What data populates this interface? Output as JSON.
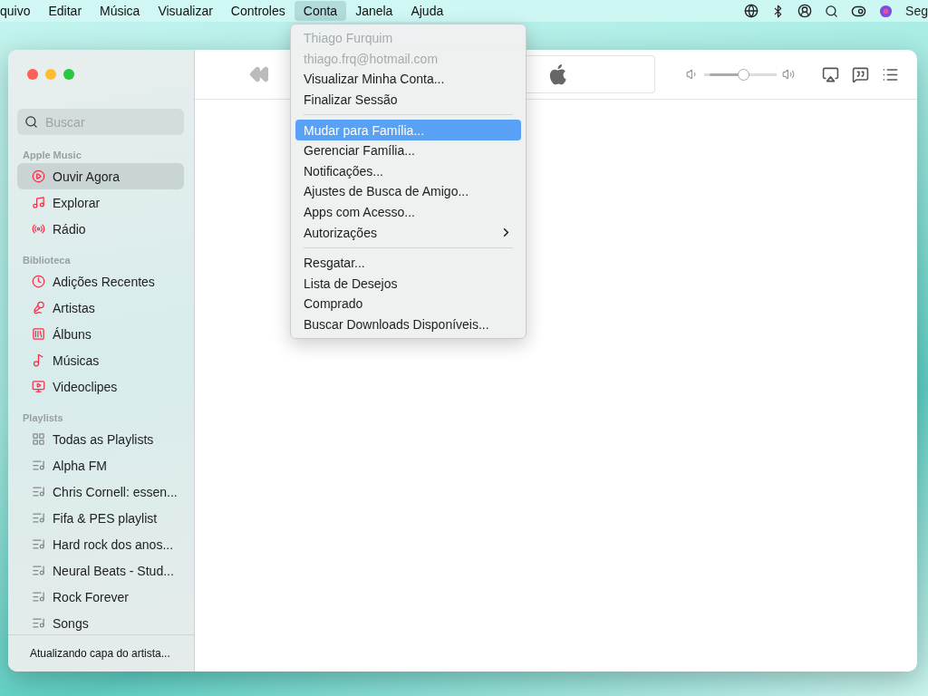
{
  "menu_bar": {
    "items": [
      {
        "label": "quivo",
        "selected": false
      },
      {
        "label": "Editar",
        "selected": false
      },
      {
        "label": "Música",
        "selected": false
      },
      {
        "label": "Visualizar",
        "selected": false
      },
      {
        "label": "Controles",
        "selected": false
      },
      {
        "label": "Conta",
        "selected": true
      },
      {
        "label": "Janela",
        "selected": false
      },
      {
        "label": "Ajuda",
        "selected": false
      }
    ],
    "status_text": "Seg"
  },
  "account_menu": {
    "items": [
      {
        "kind": "item",
        "label": "Thiago Furquim",
        "disabled": true,
        "selected": false
      },
      {
        "kind": "item",
        "label": "thiago.frq@hotmail.com",
        "disabled": true,
        "selected": false
      },
      {
        "kind": "item",
        "label": "Visualizar Minha Conta...",
        "disabled": false,
        "selected": false
      },
      {
        "kind": "item",
        "label": "Finalizar Sessão",
        "disabled": false,
        "selected": false
      },
      {
        "kind": "separator"
      },
      {
        "kind": "item",
        "label": "Mudar para Família...",
        "disabled": false,
        "selected": true
      },
      {
        "kind": "item",
        "label": "Gerenciar Família...",
        "disabled": false,
        "selected": false
      },
      {
        "kind": "item",
        "label": "Notificações...",
        "disabled": false,
        "selected": false
      },
      {
        "kind": "item",
        "label": "Ajustes de Busca de Amigo...",
        "disabled": false,
        "selected": false
      },
      {
        "kind": "item",
        "label": "Apps com Acesso...",
        "disabled": false,
        "selected": false
      },
      {
        "kind": "submenu",
        "label": "Autorizações",
        "disabled": false,
        "selected": false
      },
      {
        "kind": "separator"
      },
      {
        "kind": "item",
        "label": "Resgatar...",
        "disabled": false,
        "selected": false
      },
      {
        "kind": "item",
        "label": "Lista de Desejos",
        "disabled": false,
        "selected": false
      },
      {
        "kind": "item",
        "label": "Comprado",
        "disabled": false,
        "selected": false
      },
      {
        "kind": "item",
        "label": "Buscar Downloads Disponíveis...",
        "disabled": false,
        "selected": false
      }
    ]
  },
  "toolbar": {
    "volume": {
      "level": 0.55
    }
  },
  "sidebar": {
    "search": {
      "placeholder": "Buscar"
    },
    "sections": [
      {
        "title": "Apple Music",
        "items": [
          {
            "label": "Ouvir Agora",
            "selected": true
          },
          {
            "label": "Explorar",
            "selected": false
          },
          {
            "label": "Rádio",
            "selected": false
          }
        ]
      },
      {
        "title": "Biblioteca",
        "items": [
          {
            "label": "Adições Recentes",
            "selected": false
          },
          {
            "label": "Artistas",
            "selected": false
          },
          {
            "label": "Álbuns",
            "selected": false
          },
          {
            "label": "Músicas",
            "selected": false
          },
          {
            "label": "Videoclipes",
            "selected": false
          }
        ]
      },
      {
        "title": "Playlists",
        "items": [
          {
            "label": "Todas as Playlists",
            "selected": false
          },
          {
            "label": "Alpha FM",
            "selected": false
          },
          {
            "label": "Chris Cornell: essen...",
            "selected": false
          },
          {
            "label": "Fifa & PES playlist",
            "selected": false
          },
          {
            "label": "Hard rock dos anos...",
            "selected": false
          },
          {
            "label": "Neural Beats - Stud...",
            "selected": false
          },
          {
            "label": "Rock Forever",
            "selected": false
          },
          {
            "label": "Songs",
            "selected": false
          }
        ]
      }
    ],
    "status": "Atualizando capa do artista..."
  }
}
